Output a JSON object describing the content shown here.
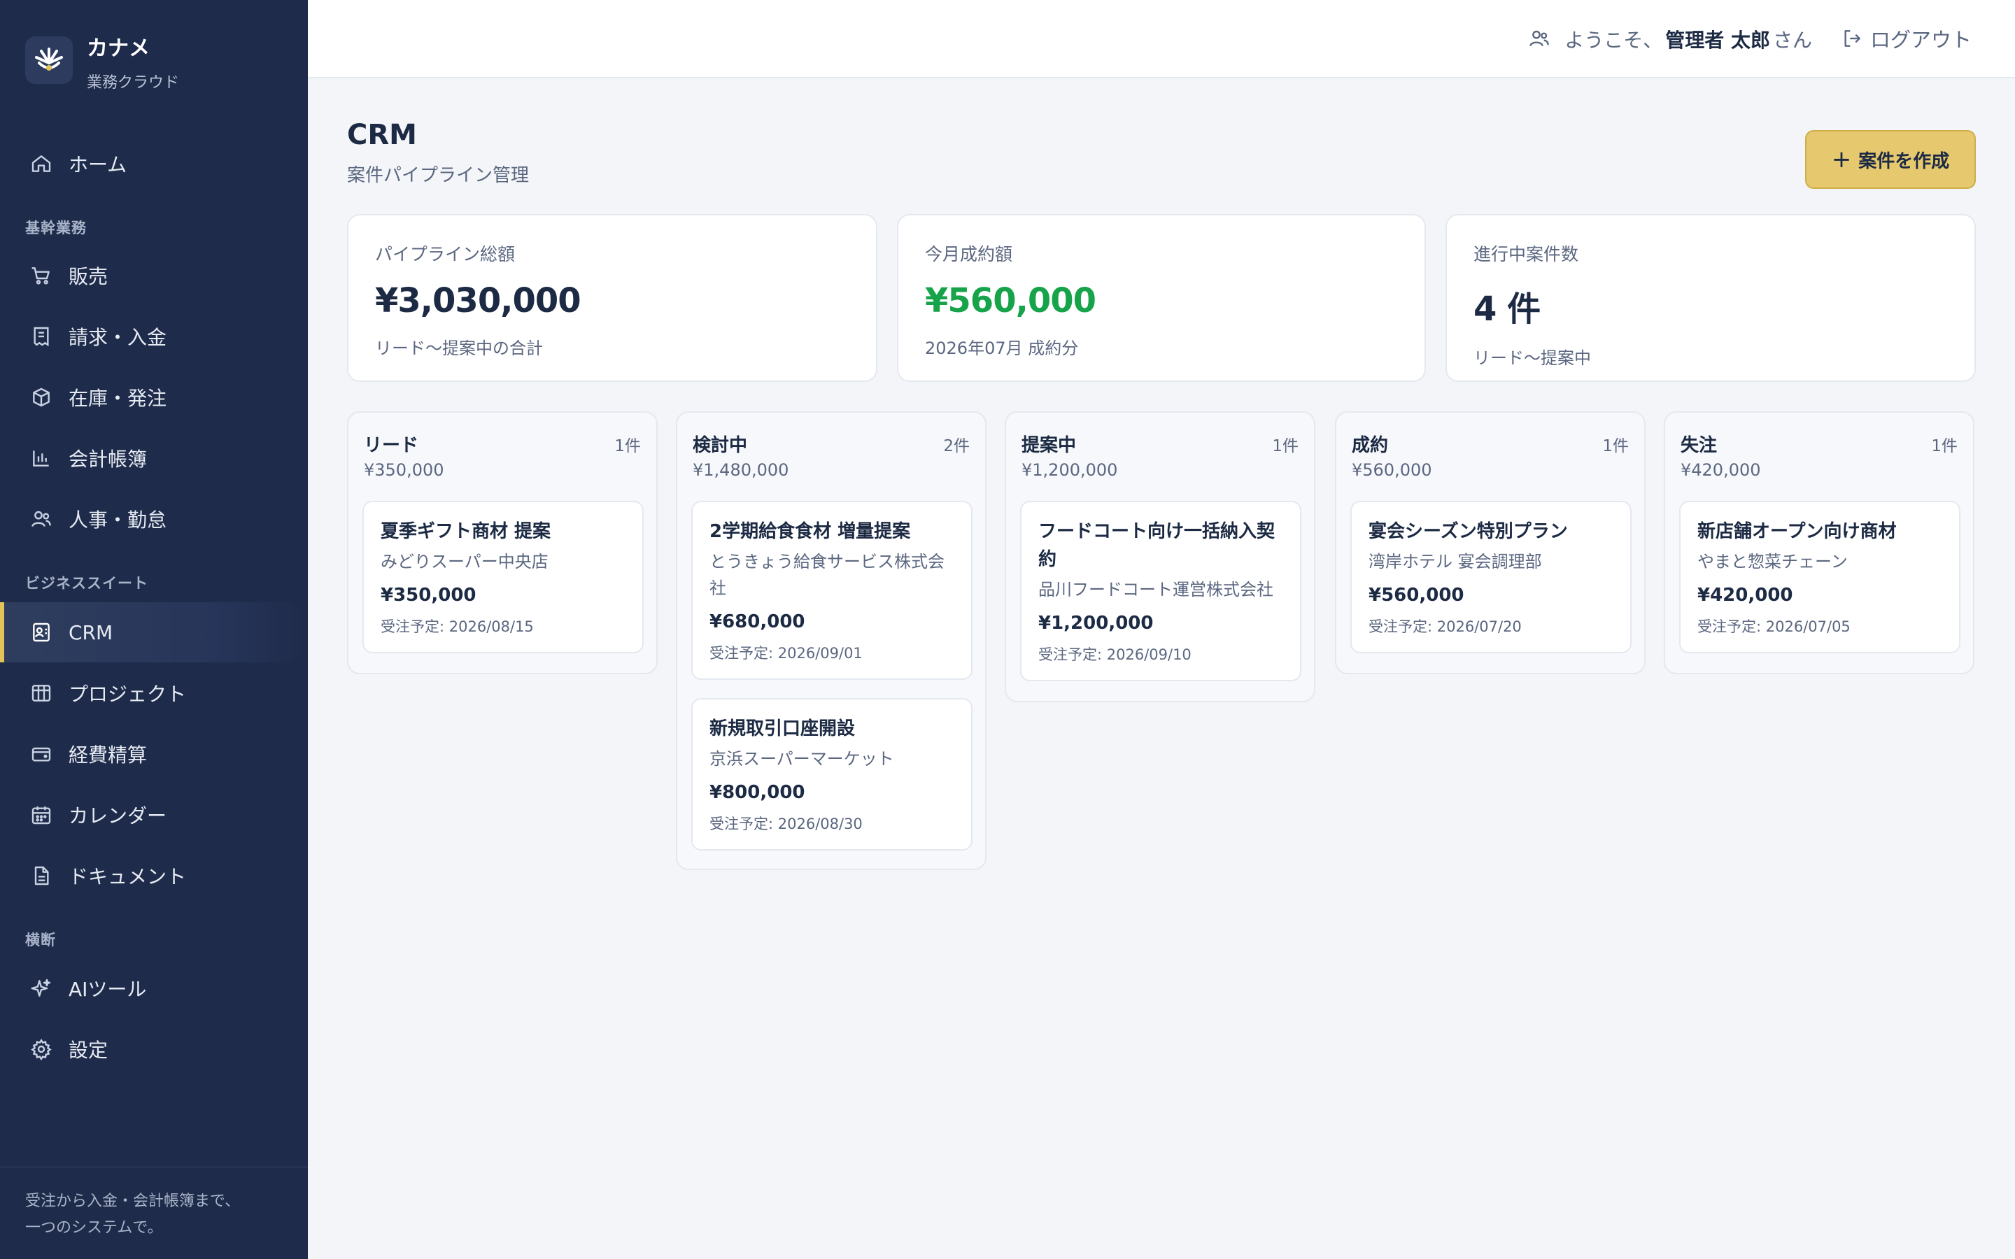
{
  "brand": {
    "name": "カナメ",
    "subtitle": "業務クラウド"
  },
  "sidebar": {
    "home": {
      "label": "ホーム",
      "icon": "home-icon"
    },
    "section_core": "基幹業務",
    "core_items": [
      {
        "label": "販売",
        "icon": "cart-icon"
      },
      {
        "label": "請求・入金",
        "icon": "receipt-icon"
      },
      {
        "label": "在庫・発注",
        "icon": "box-icon"
      },
      {
        "label": "会計帳簿",
        "icon": "bar-chart-icon"
      },
      {
        "label": "人事・勤怠",
        "icon": "users-icon"
      }
    ],
    "section_suite": "ビジネススイート",
    "suite_items": [
      {
        "label": "CRM",
        "icon": "contact-card-icon",
        "active": true
      },
      {
        "label": "プロジェクト",
        "icon": "kanban-icon"
      },
      {
        "label": "経費精算",
        "icon": "wallet-icon"
      },
      {
        "label": "カレンダー",
        "icon": "calendar-icon"
      },
      {
        "label": "ドキュメント",
        "icon": "document-icon"
      }
    ],
    "section_cross": "横断",
    "cross_items": [
      {
        "label": "AIツール",
        "icon": "sparkle-icon"
      },
      {
        "label": "設定",
        "icon": "gear-icon"
      }
    ],
    "footer_line1": "受注から入金・会計帳簿まで、",
    "footer_line2": "一つのシステムで。"
  },
  "topbar": {
    "welcome_prefix": "ようこそ、",
    "user_name": "管理者 太郎",
    "welcome_suffix": "さん",
    "logout_label": "ログアウト"
  },
  "page": {
    "title": "CRM",
    "subtitle": "案件パイプライン管理",
    "create_button": "案件を作成"
  },
  "stats": [
    {
      "label": "パイプライン総額",
      "value": "¥3,030,000",
      "note": "リード〜提案中の合計"
    },
    {
      "label": "今月成約額",
      "value": "¥560,000",
      "note": "2026年07月 成約分"
    },
    {
      "label": "進行中案件数",
      "value": "4 件",
      "note": "リード〜提案中"
    }
  ],
  "columns": [
    {
      "title": "リード",
      "count": "1件",
      "total": "¥350,000",
      "deals": [
        {
          "title": "夏季ギフト商材 提案",
          "company": "みどりスーパー中央店",
          "amount": "¥350,000",
          "date": "受注予定: 2026/08/15"
        }
      ]
    },
    {
      "title": "検討中",
      "count": "2件",
      "total": "¥1,480,000",
      "deals": [
        {
          "title": "2学期給食食材 増量提案",
          "company": "とうきょう給食サービス株式会社",
          "amount": "¥680,000",
          "date": "受注予定: 2026/09/01"
        },
        {
          "title": "新規取引口座開設",
          "company": "京浜スーパーマーケット",
          "amount": "¥800,000",
          "date": "受注予定: 2026/08/30"
        }
      ]
    },
    {
      "title": "提案中",
      "count": "1件",
      "total": "¥1,200,000",
      "deals": [
        {
          "title": "フードコート向け一括納入契約",
          "company": "品川フードコート運営株式会社",
          "amount": "¥1,200,000",
          "date": "受注予定: 2026/09/10"
        }
      ]
    },
    {
      "title": "成約",
      "count": "1件",
      "total": "¥560,000",
      "deals": [
        {
          "title": "宴会シーズン特別プラン",
          "company": "湾岸ホテル 宴会調理部",
          "amount": "¥560,000",
          "date": "受注予定: 2026/07/20"
        }
      ]
    },
    {
      "title": "失注",
      "count": "1件",
      "total": "¥420,000",
      "deals": [
        {
          "title": "新店舗オープン向け商材",
          "company": "やまと惣菜チェーン",
          "amount": "¥420,000",
          "date": "受注予定: 2026/07/05"
        }
      ]
    }
  ],
  "colors": {
    "sidebar": "#1e2b4a",
    "accent": "#e3c35a",
    "button": "#e6c86e",
    "success": "#16a34a"
  }
}
